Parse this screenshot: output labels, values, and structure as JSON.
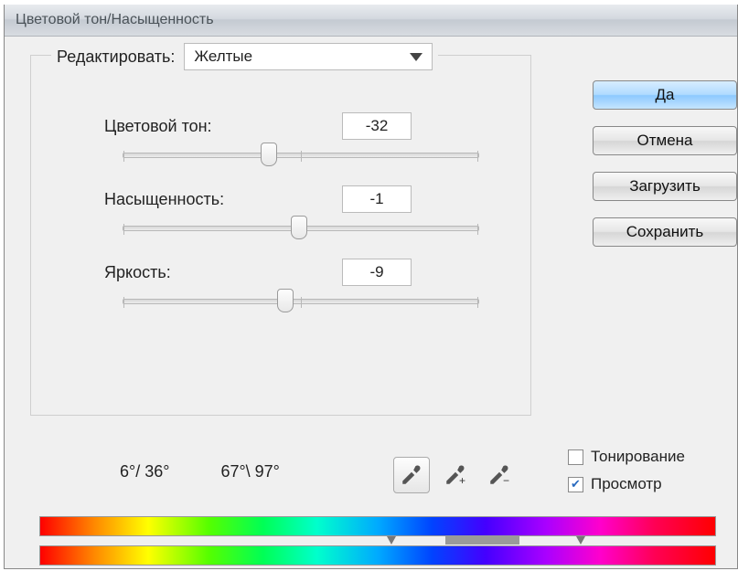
{
  "title": "Цветовой тон/Насыщенность",
  "fieldset": {
    "legend": "Редактировать:",
    "edit_value": "Желтые",
    "hue_label": "Цветовой тон:",
    "hue_value": "-32",
    "sat_label": "Насыщенность:",
    "sat_value": "-1",
    "light_label": "Яркость:",
    "light_value": "-9"
  },
  "buttons": {
    "ok": "Да",
    "cancel": "Отмена",
    "load": "Загрузить",
    "save": "Сохранить"
  },
  "range": {
    "left": "6°/ 36°",
    "right": "67°\\ 97°"
  },
  "checks": {
    "colorize": "Тонирование",
    "preview": "Просмотр",
    "colorize_checked": false,
    "preview_checked": true
  },
  "icons": {
    "eyedropper": "eyedropper-icon",
    "eyedropper_plus": "eyedropper-plus-icon",
    "eyedropper_minus": "eyedropper-minus-icon"
  }
}
